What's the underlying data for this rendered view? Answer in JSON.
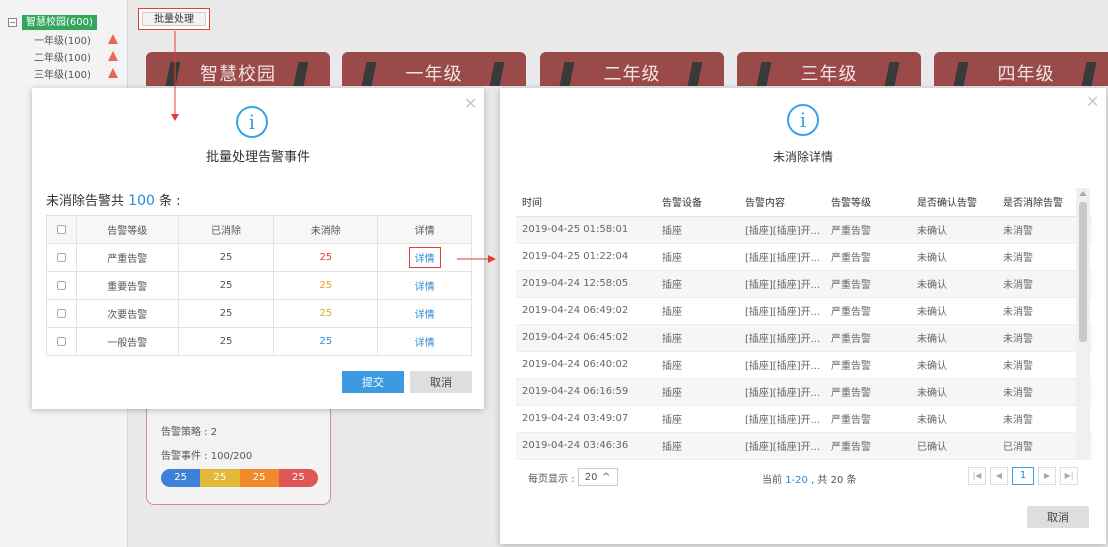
{
  "tree": {
    "root": "智慧校园(600)",
    "items": [
      "一年级(100)",
      "二年级(100)",
      "三年级(100)"
    ]
  },
  "toolbar": {
    "batch_label": "批量处理"
  },
  "cards": [
    "智慧校园",
    "一年级",
    "二年级",
    "三年级",
    "四年级"
  ],
  "bg_panel": {
    "strategy": "告警策略 : 2",
    "events": "告警事件 : 100/200",
    "bar": [
      "25",
      "25",
      "25",
      "25"
    ]
  },
  "dialog1": {
    "title": "批量处理告警事件",
    "summary_prefix": "未消除告警共",
    "summary_count": "100",
    "summary_suffix": "条 :",
    "columns": [
      "告警等级",
      "已消除",
      "未消除",
      "详情"
    ],
    "rows": [
      {
        "level": "严重告警",
        "cleared": "25",
        "uncleared": "25",
        "detail": "详情"
      },
      {
        "level": "重要告警",
        "cleared": "25",
        "uncleared": "25",
        "detail": "详情"
      },
      {
        "level": "次要告警",
        "cleared": "25",
        "uncleared": "25",
        "detail": "详情"
      },
      {
        "level": "一般告警",
        "cleared": "25",
        "uncleared": "25",
        "detail": "详情"
      }
    ],
    "submit_label": "提交",
    "cancel_label": "取消"
  },
  "dialog2": {
    "title": "未消除详情",
    "columns": [
      "时间",
      "告警设备",
      "告警内容",
      "告警等级",
      "是否确认告警",
      "是否消除告警"
    ],
    "rows": [
      [
        "2019-04-25 01:58:01",
        "插座",
        "[插座][插座]开...",
        "严重告警",
        "未确认",
        "未消警"
      ],
      [
        "2019-04-25 01:22:04",
        "插座",
        "[插座][插座]开...",
        "严重告警",
        "未确认",
        "未消警"
      ],
      [
        "2019-04-24 12:58:05",
        "插座",
        "[插座][插座]开...",
        "严重告警",
        "未确认",
        "未消警"
      ],
      [
        "2019-04-24 06:49:02",
        "插座",
        "[插座][插座]开...",
        "严重告警",
        "未确认",
        "未消警"
      ],
      [
        "2019-04-24 06:45:02",
        "插座",
        "[插座][插座]开...",
        "严重告警",
        "未确认",
        "未消警"
      ],
      [
        "2019-04-24 06:40:02",
        "插座",
        "[插座][插座]开...",
        "严重告警",
        "未确认",
        "未消警"
      ],
      [
        "2019-04-24 06:16:59",
        "插座",
        "[插座][插座]开...",
        "严重告警",
        "未确认",
        "未消警"
      ],
      [
        "2019-04-24 03:49:07",
        "插座",
        "[插座][插座]开...",
        "严重告警",
        "未确认",
        "未消警"
      ],
      [
        "2019-04-24 03:46:36",
        "插座",
        "[插座][插座]开...",
        "严重告警",
        "已确认",
        "已消警"
      ]
    ],
    "page_size_label": "每页显示 :",
    "page_size": "20",
    "pager_prefix": "当前",
    "pager_range": "1-20",
    "pager_suffix": ", 共 20 条",
    "current_page": "1",
    "cancel_label": "取消"
  },
  "colors": {
    "level_critical": "#e53b3b",
    "level_major": "#f0a020",
    "level_minor": "#d4b21a",
    "level_normal": "#2a8ad9",
    "accent": "#3aa3e3"
  }
}
